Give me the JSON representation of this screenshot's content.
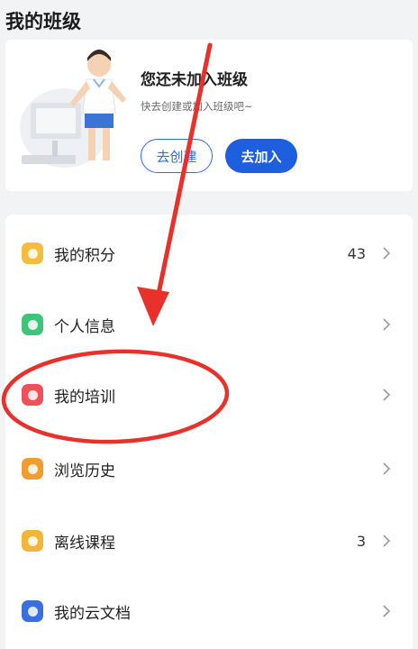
{
  "section_title": "我的班级",
  "class_card": {
    "heading": "您还未加入班级",
    "subtext": "快去创建或加入班级吧~",
    "create_button": "去创建",
    "join_button": "去加入"
  },
  "menu": {
    "items": [
      {
        "label": "我的积分",
        "count": "43",
        "icon": "star-badge-icon",
        "color": "#f4bd3c"
      },
      {
        "label": "个人信息",
        "count": "",
        "icon": "person-card-icon",
        "color": "#3fc57a"
      },
      {
        "label": "我的培训",
        "count": "",
        "icon": "training-icon",
        "color": "#f0505a"
      },
      {
        "label": "浏览历史",
        "count": "",
        "icon": "history-icon",
        "color": "#f29b2e"
      },
      {
        "label": "离线课程",
        "count": "3",
        "icon": "offline-course-icon",
        "color": "#f3b535"
      },
      {
        "label": "我的云文档",
        "count": "",
        "icon": "cloud-doc-icon",
        "color": "#3b6fe0"
      }
    ]
  },
  "annotation_colors": {
    "arrow": "#e8312a",
    "ellipse": "#e8312a"
  }
}
